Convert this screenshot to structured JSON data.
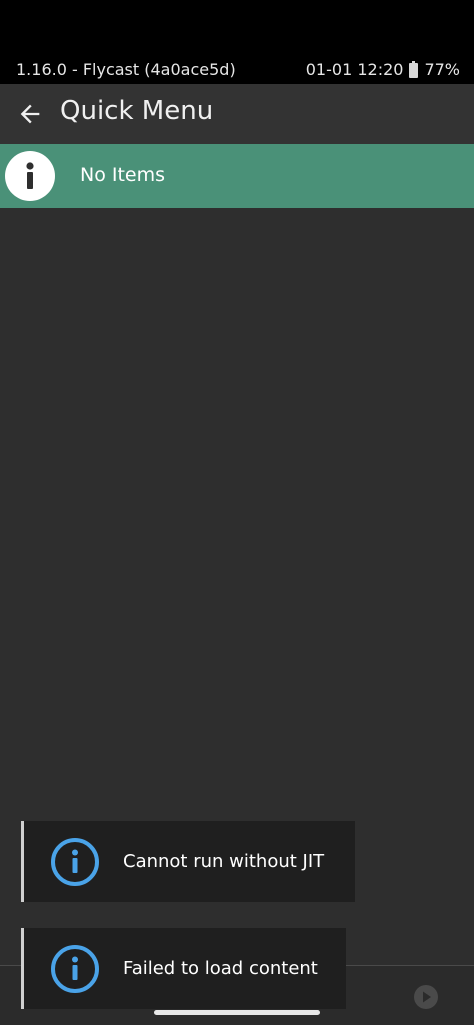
{
  "status_bar": {
    "app_version": "1.16.0 - Flycast (4a0ace5d)",
    "datetime": "01-01 12:20",
    "battery_percent": "77%",
    "battery_icon": "battery-icon"
  },
  "header": {
    "back_icon": "arrow-left-icon",
    "title": "Quick Menu"
  },
  "menu": {
    "empty_icon": "info-icon",
    "empty_label": "No Items"
  },
  "toasts": [
    {
      "icon": "info-icon",
      "message": "Cannot run without JIT"
    },
    {
      "icon": "info-icon",
      "message": "Failed to load content"
    }
  ],
  "colors": {
    "accent_green": "#4a9178",
    "info_blue": "#4aa3e8",
    "background": "#2e2e2e"
  }
}
